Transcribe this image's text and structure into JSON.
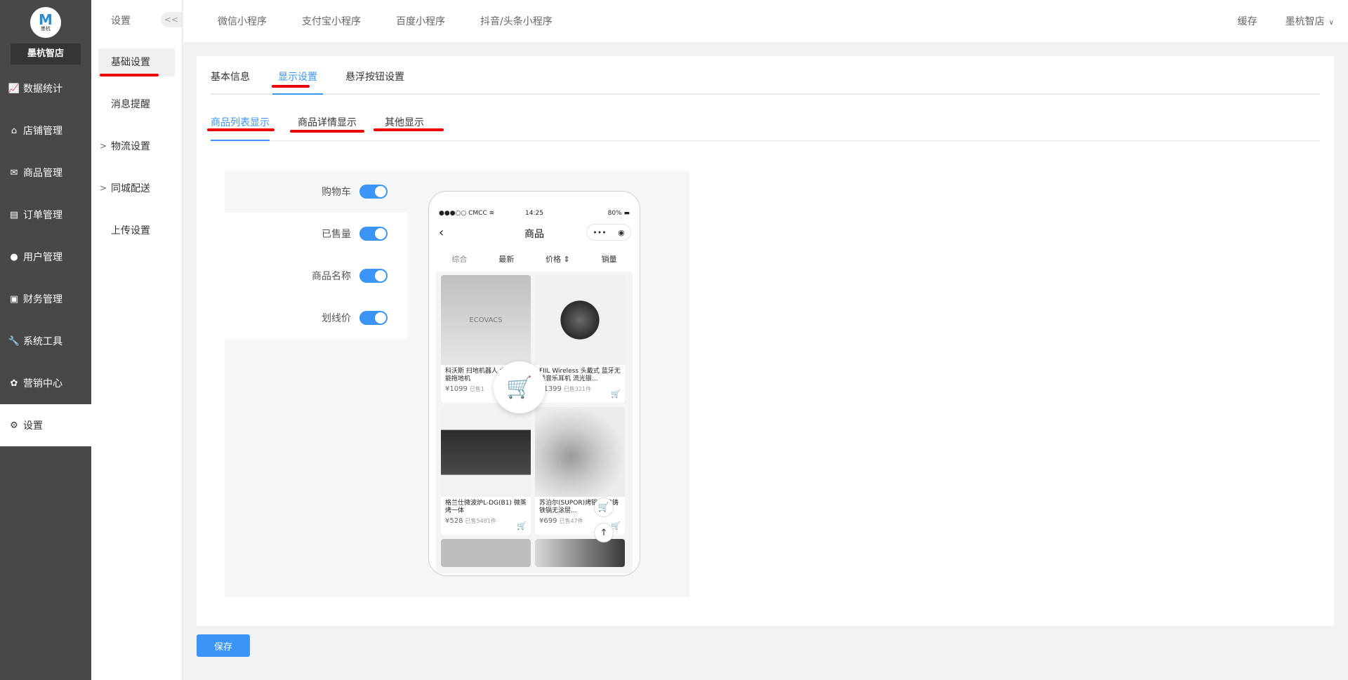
{
  "brand": {
    "logo_letter": "M",
    "logo_sub": "墨杭",
    "store_name": "墨杭智店"
  },
  "sidebar": {
    "items": [
      {
        "label": "数据统计",
        "icon": "chart-icon"
      },
      {
        "label": "店铺管理",
        "icon": "shop-icon"
      },
      {
        "label": "商品管理",
        "icon": "goods-icon"
      },
      {
        "label": "订单管理",
        "icon": "order-icon"
      },
      {
        "label": "用户管理",
        "icon": "user-icon"
      },
      {
        "label": "财务管理",
        "icon": "finance-icon"
      },
      {
        "label": "系统工具",
        "icon": "wrench-icon"
      },
      {
        "label": "营销中心",
        "icon": "marketing-icon"
      },
      {
        "label": "设置",
        "icon": "gear-icon"
      }
    ]
  },
  "subnav": {
    "title": "设置",
    "collapse": "<<",
    "items": [
      {
        "label": "基础设置"
      },
      {
        "label": "消息提醒"
      },
      {
        "label": "物流设置",
        "arrow": ">"
      },
      {
        "label": "同城配送",
        "arrow": ">"
      },
      {
        "label": "上传设置"
      }
    ]
  },
  "topbar": {
    "tabs": [
      "微信小程序",
      "支付宝小程序",
      "百度小程序",
      "抖音/头条小程序"
    ],
    "cache": "缓存",
    "user": "墨杭智店",
    "user_caret": "∨"
  },
  "tabs1": [
    "基本信息",
    "显示设置",
    "悬浮按钮设置"
  ],
  "tabs2": [
    "商品列表显示",
    "商品详情显示",
    "其他显示"
  ],
  "options": [
    {
      "label": "购物车",
      "on": true
    },
    {
      "label": "已售量",
      "on": true
    },
    {
      "label": "商品名称",
      "on": true
    },
    {
      "label": "划线价",
      "on": true
    }
  ],
  "phone": {
    "status_left": "●●●○○ CMCC ≋",
    "status_time": "14:25",
    "status_right": "80% ▬",
    "title": "商品",
    "back": "‹",
    "caps_more": "•••",
    "caps_target": "◉",
    "sort": [
      "综合",
      "最新",
      "价格 ⇕",
      "销量"
    ],
    "cart_glyph": "🛒",
    "top_glyph": "↑",
    "products": [
      {
        "name": "科沃斯 扫地机器人 全自动智能拖地机",
        "price": "¥1099",
        "sold": "已售1",
        "img": "ECOVACS"
      },
      {
        "name": "FIIL Wireless 头戴式 蓝牙无 线音乐耳机 流光银...",
        "price": "¥1399",
        "sold": "已售321件",
        "img": ""
      },
      {
        "name": "格兰仕微波炉L-DG(B1) 微蒸烤一体",
        "price": "¥528",
        "sold": "已售5481件",
        "img": ""
      },
      {
        "name": "苏泊尔(SUPOR)烤锅 珐琅铸铁锅无涂层...",
        "price": "¥699",
        "sold": "已售47件",
        "img": ""
      }
    ]
  },
  "save_label": "保存",
  "colors": {
    "accent": "#3b95f6",
    "sidebar_bg": "#484848",
    "annotation_red": "#ee0000",
    "cart_red": "#ec3c3c"
  }
}
